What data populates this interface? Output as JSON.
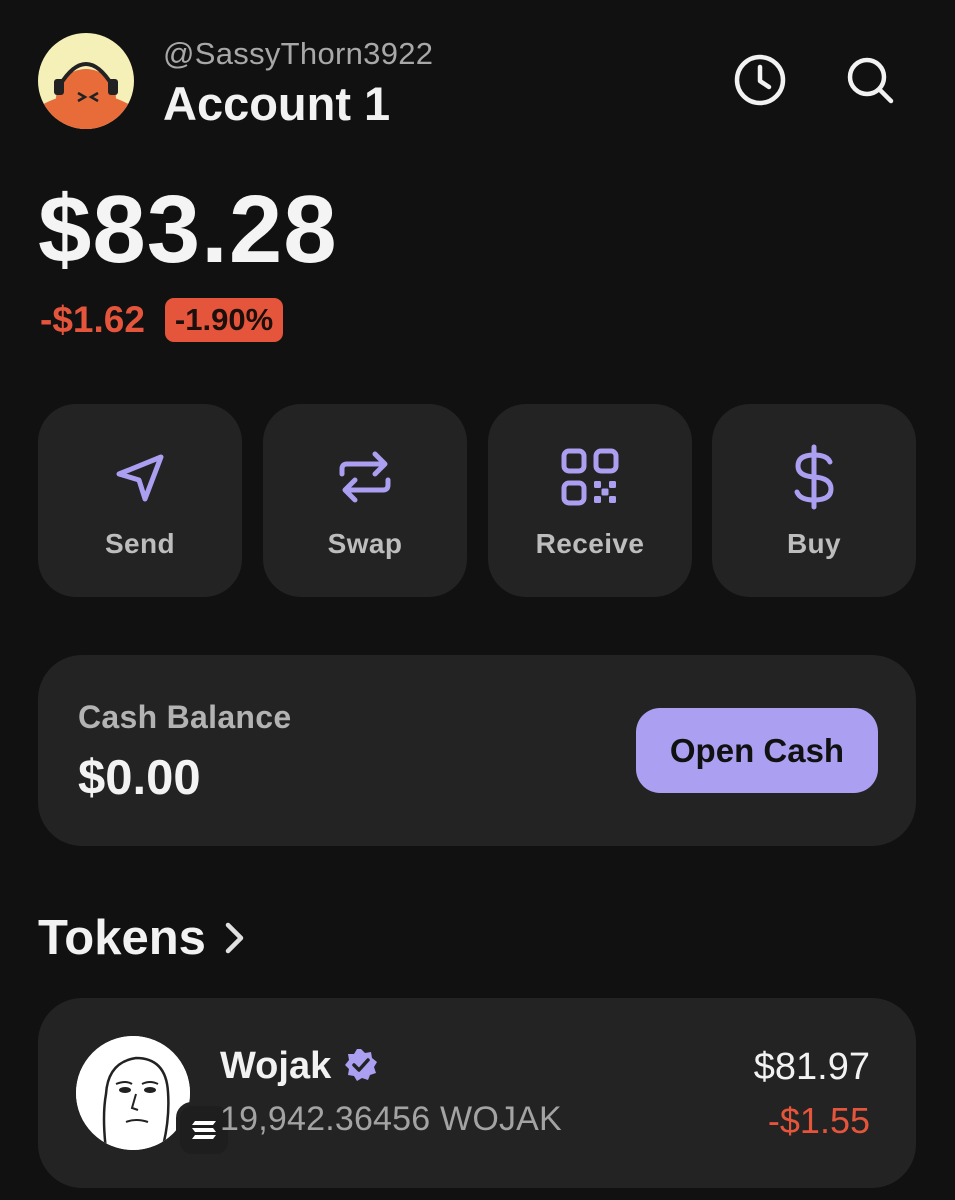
{
  "header": {
    "handle": "@SassyThorn3922",
    "account_name": "Account 1"
  },
  "balance": {
    "total": "$83.28",
    "change_amount": "-$1.62",
    "change_percent": "-1.90%"
  },
  "actions": [
    {
      "label": "Send",
      "icon": "send-icon"
    },
    {
      "label": "Swap",
      "icon": "swap-icon"
    },
    {
      "label": "Receive",
      "icon": "qr-code-icon"
    },
    {
      "label": "Buy",
      "icon": "dollar-icon"
    }
  ],
  "cash": {
    "label": "Cash Balance",
    "value": "$0.00",
    "button_label": "Open Cash"
  },
  "tokens": {
    "title": "Tokens",
    "items": [
      {
        "name": "Wojak",
        "amount": "19,942.36456 WOJAK",
        "value": "$81.97",
        "change": "-$1.55"
      }
    ]
  },
  "colors": {
    "background": "#111111",
    "card": "#232323",
    "accent_purple": "#ab9ff2",
    "negative_red": "#e5553b"
  }
}
